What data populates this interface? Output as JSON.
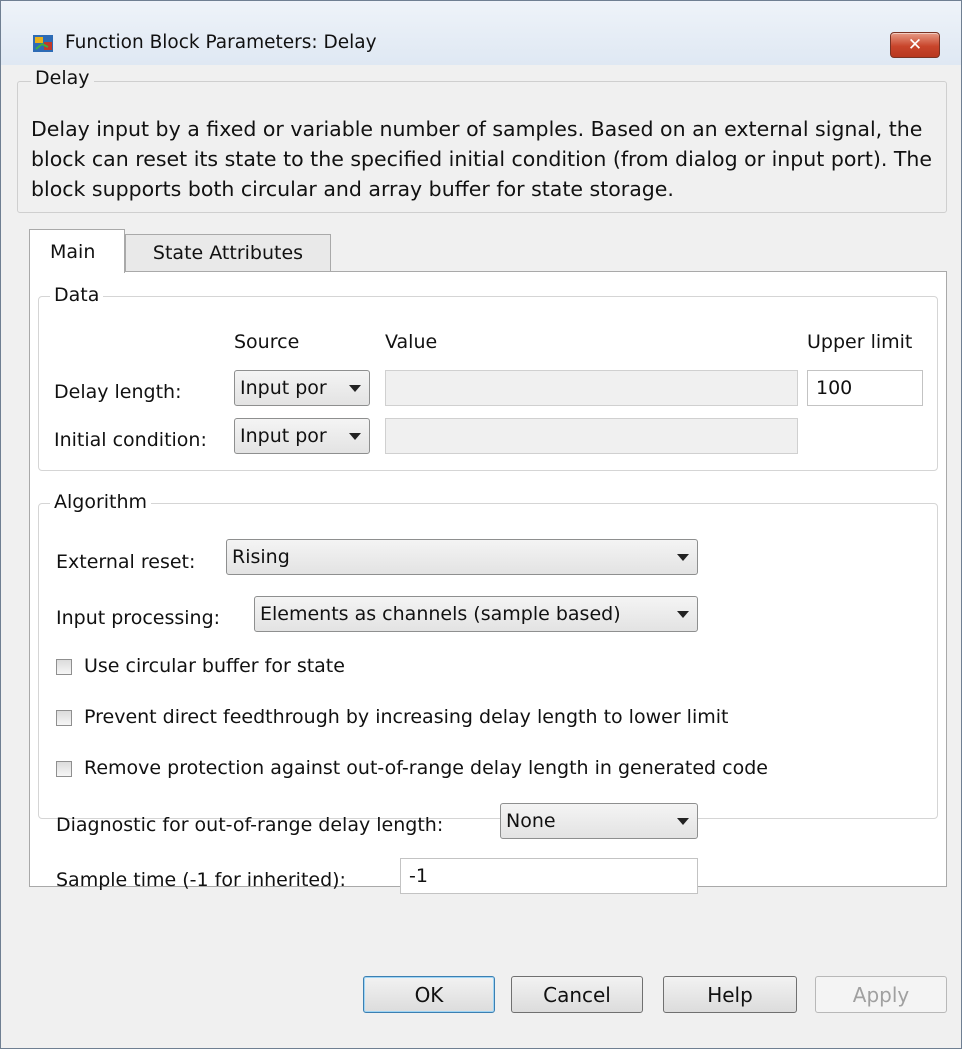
{
  "window": {
    "title": "Function Block Parameters: Delay",
    "close_label": "✕"
  },
  "description": {
    "legend": "Delay",
    "text": "Delay input by a fixed or variable number of samples. Based on an external signal, the block can reset its state to the specified initial condition (from dialog or input port). The block supports both circular and array buffer for state storage."
  },
  "tabs": [
    {
      "label": "Main",
      "selected": true
    },
    {
      "label": "State Attributes",
      "selected": false
    }
  ],
  "data_group": {
    "legend": "Data",
    "col_source": "Source",
    "col_value": "Value",
    "col_upper_limit": "Upper limit",
    "delay_length": {
      "label": "Delay length:",
      "source": "Input por",
      "value": "",
      "upper_limit": "100"
    },
    "initial_condition": {
      "label": "Initial condition:",
      "source": "Input por",
      "value": ""
    }
  },
  "algorithm_group": {
    "legend": "Algorithm",
    "external_reset": {
      "label": "External reset:",
      "value": "Rising"
    },
    "input_processing": {
      "label": "Input processing:",
      "value": "Elements as channels (sample based)"
    },
    "checkboxes": [
      {
        "label": "Use circular buffer for state",
        "checked": false
      },
      {
        "label": "Prevent direct feedthrough by increasing delay length to lower limit",
        "checked": false
      },
      {
        "label": "Remove protection against out-of-range delay length in generated code",
        "checked": false
      }
    ],
    "diagnostic": {
      "label": "Diagnostic for out-of-range delay length:",
      "value": "None"
    },
    "sample_time": {
      "label": "Sample time (-1 for inherited):",
      "value": "-1"
    }
  },
  "buttons": {
    "ok": "OK",
    "cancel": "Cancel",
    "help": "Help",
    "apply": "Apply"
  },
  "colors": {
    "window_bg": "#f0f0f0",
    "panel_bg": "#ffffff",
    "close_button": "#c8452b",
    "default_button_border": "#3c7fb1"
  }
}
